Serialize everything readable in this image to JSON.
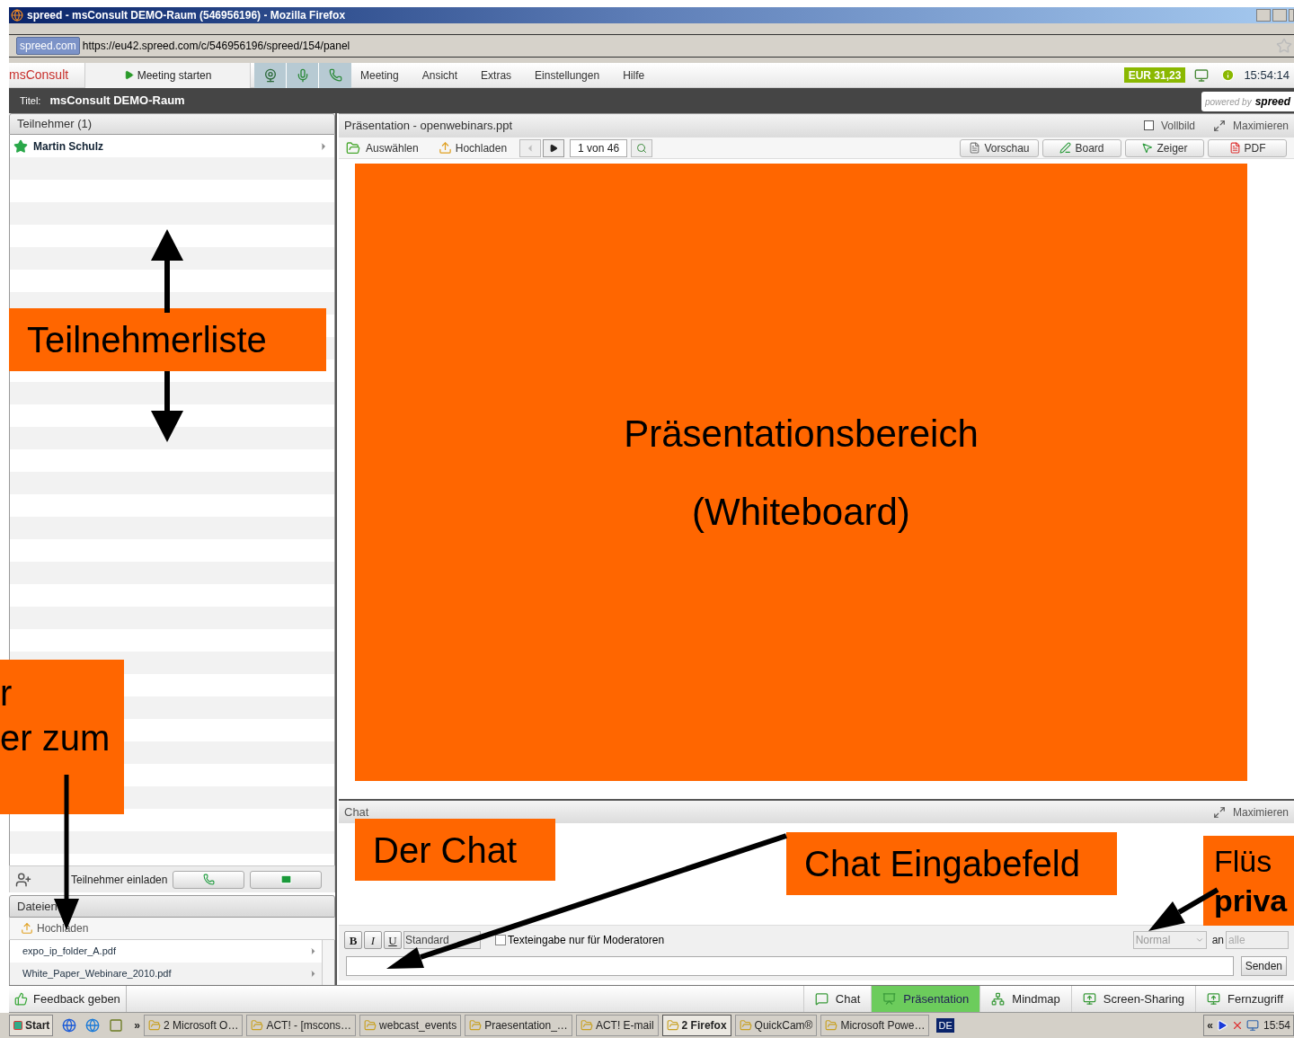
{
  "window": {
    "title": "spreed - msConsult DEMO-Raum (546956196) - Mozilla Firefox"
  },
  "address_bar": {
    "site_badge": "spreed.com",
    "url": "https://eu42.spreed.com/c/546956196/spreed/154/panel"
  },
  "app_bar": {
    "logo": "msConsult",
    "start_button": "Meeting starten",
    "menu": [
      "Meeting",
      "Ansicht",
      "Extras",
      "Einstellungen",
      "Hilfe"
    ],
    "balance": "EUR 31,23",
    "time": "15:54:14"
  },
  "room": {
    "label": "Titel:",
    "name": "msConsult DEMO-Raum",
    "powered_by": "powered by",
    "brand": "spreed"
  },
  "participants": {
    "title": "Teilnehmer (1)",
    "items": [
      {
        "name": "Martin Schulz"
      }
    ],
    "invite": "Teilnehmer einladen"
  },
  "files": {
    "title": "Dateien",
    "upload": "Hochladen",
    "items": [
      "expo_ip_folder_A.pdf",
      "White_Paper_Webinare_2010.pdf"
    ]
  },
  "feedback": "Feedback geben",
  "presentation": {
    "title": "Präsentation - openwebinars.ppt",
    "fullscreen": {
      "label": "Vollbild",
      "checked": false
    },
    "maximize": "Maximieren",
    "select": "Auswählen",
    "upload": "Hochladen",
    "page": "1 von 46",
    "tools": [
      "Vorschau",
      "Board",
      "Zeiger",
      "PDF"
    ],
    "slide": {
      "lines": [
        "Präsentationsbereich",
        "(Whiteboard)"
      ]
    }
  },
  "chat": {
    "title": "Chat",
    "maximize": "Maximieren",
    "format_buttons": [
      "B",
      "I",
      "U"
    ],
    "style_select": "Standard",
    "moderators_only": {
      "label": "Texteingabe nur für Moderatoren",
      "checked": false
    },
    "mode_select": "Normal",
    "to_label": "an",
    "recipient_select": "alle",
    "send": "Senden"
  },
  "bottom_tabs": [
    {
      "label": "Chat",
      "selected": false
    },
    {
      "label": "Präsentation",
      "selected": true
    },
    {
      "label": "Mindmap",
      "selected": false
    },
    {
      "label": "Screen-Sharing",
      "selected": false
    },
    {
      "label": "Fernzugriff",
      "selected": false
    }
  ],
  "taskbar": {
    "start": "Start",
    "more": "»",
    "items": [
      {
        "label": "2 Microsoft O…",
        "selected": false
      },
      {
        "label": "ACT! - [mscons…",
        "selected": false
      },
      {
        "label": "webcast_events",
        "selected": false
      },
      {
        "label": "Praesentation_…",
        "selected": false
      },
      {
        "label": "ACT! E-mail",
        "selected": false
      },
      {
        "label": "2 Firefox",
        "selected": true
      },
      {
        "label": "QuickCam®",
        "selected": false
      },
      {
        "label": "Microsoft Powe…",
        "selected": false
      }
    ],
    "language": "DE",
    "tray_toggle": "«",
    "clock": "15:54"
  },
  "annotations": [
    {
      "lines": [
        {
          "text": "Teilnehmerliste",
          "bold": false
        }
      ]
    },
    {
      "lines": [
        {
          "text": "r",
          "bold": false
        },
        {
          "text": "er zum",
          "bold": false
        }
      ]
    },
    {
      "lines": [
        {
          "text": "Der Chat",
          "bold": false
        }
      ]
    },
    {
      "lines": [
        {
          "text": "Chat Eingabefeld",
          "bold": false
        }
      ]
    },
    {
      "lines": [
        {
          "text": "Flüs",
          "bold": false
        },
        {
          "text": "priva",
          "bold": true
        }
      ]
    }
  ]
}
